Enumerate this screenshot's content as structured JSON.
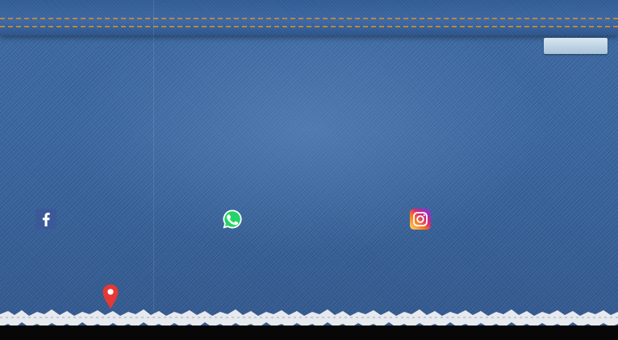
{
  "colors": {
    "denim": "#3a67a0",
    "stitch": "#c98a3c",
    "facebook": "#3b5998",
    "whatsapp": "#25d366",
    "pin": "#e53935"
  },
  "icons": {
    "facebook": "facebook-icon",
    "whatsapp": "whatsapp-icon",
    "instagram": "instagram-icon",
    "location": "location-pin-icon"
  }
}
